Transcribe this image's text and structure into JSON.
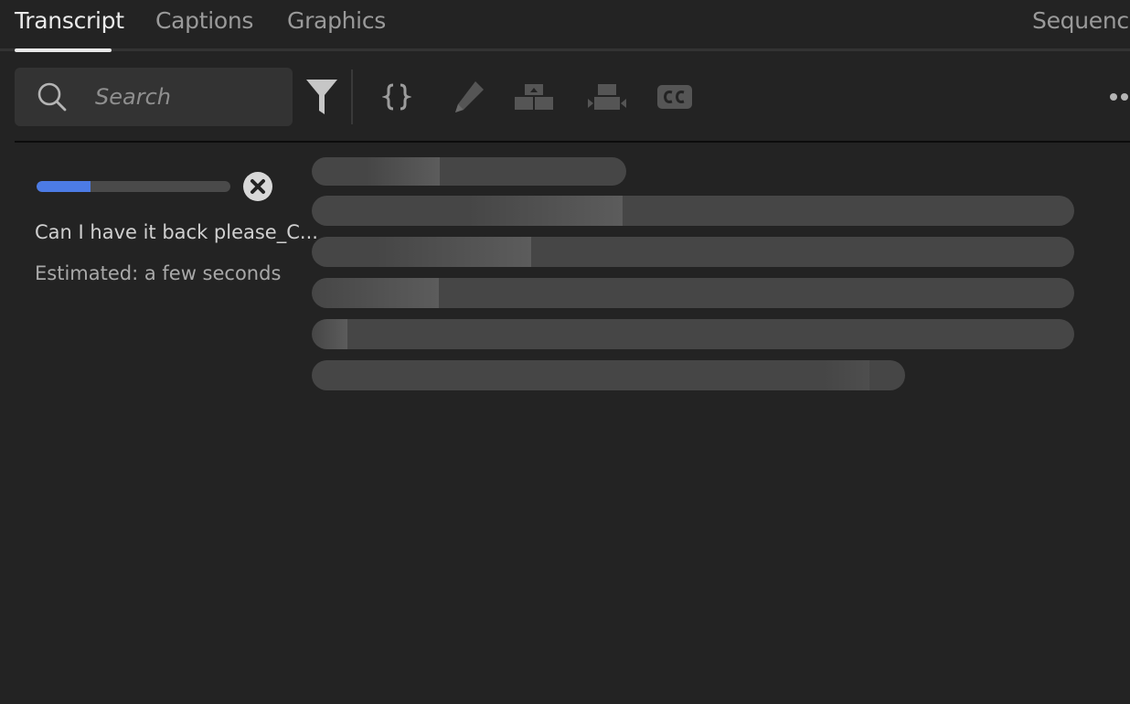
{
  "tabs": [
    {
      "label": "Transcript",
      "active": true
    },
    {
      "label": "Captions",
      "active": false
    },
    {
      "label": "Graphics",
      "active": false
    },
    {
      "label": "Sequence",
      "active": false
    }
  ],
  "search": {
    "placeholder": "Search",
    "value": ""
  },
  "toolbar": {
    "icons": [
      "filter-icon",
      "code-braces-icon",
      "pencil-icon",
      "merge-segments-icon",
      "split-segment-icon",
      "cc-icon",
      "more-icon"
    ]
  },
  "transcribe": {
    "progress_percent": 28,
    "filename": "Can I have it back please_C...",
    "estimated": "Estimated: a few seconds"
  },
  "colors": {
    "background": "#232323",
    "panel": "#333333",
    "accent": "#4c7be5",
    "skeleton": "#464646"
  }
}
